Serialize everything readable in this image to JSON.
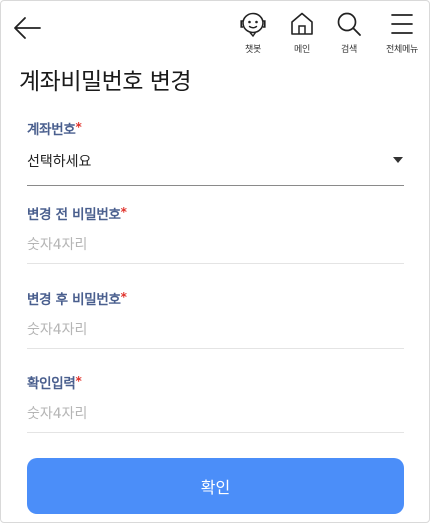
{
  "header": {
    "nav": {
      "chatbot": "챗봇",
      "main": "메인",
      "search": "검색",
      "menu": "전체메뉴"
    }
  },
  "page": {
    "title": "계좌비밀번호 변경"
  },
  "form": {
    "account": {
      "label": "계좌번호",
      "required": "*",
      "value": "선택하세요"
    },
    "old_password": {
      "label": "변경 전 비밀번호",
      "required": "*",
      "placeholder": "숫자4자리"
    },
    "new_password": {
      "label": "변경 후 비밀번호",
      "required": "*",
      "placeholder": "숫자4자리"
    },
    "confirm_password": {
      "label": "확인입력",
      "required": "*",
      "placeholder": "숫자4자리"
    }
  },
  "actions": {
    "confirm_label": "확인"
  },
  "colors": {
    "label": "#4a5f8e",
    "required": "#e0322b",
    "button": "#4b8ef9"
  }
}
